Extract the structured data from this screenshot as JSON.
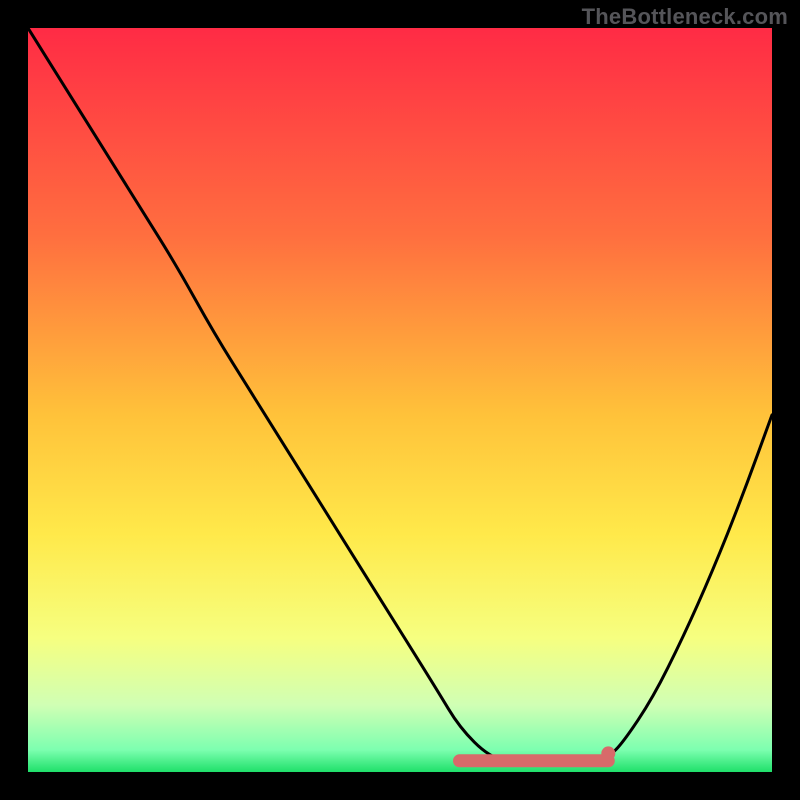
{
  "attribution": "TheBottleneck.com",
  "colors": {
    "gradient_top": "#ff2b45",
    "gradient_mid_upper": "#ff7a3c",
    "gradient_mid": "#ffd23f",
    "gradient_mid_lower": "#f6ff66",
    "gradient_lower": "#d6ffb0",
    "gradient_bottom": "#22e26b",
    "curve": "#000000",
    "highlight": "#d86a6a",
    "frame": "#000000"
  },
  "chart_data": {
    "type": "line",
    "title": "",
    "xlabel": "",
    "ylabel": "",
    "xlim": [
      0,
      1
    ],
    "ylim": [
      0,
      1
    ],
    "series": [
      {
        "name": "curve",
        "x": [
          0.0,
          0.05,
          0.1,
          0.15,
          0.2,
          0.25,
          0.3,
          0.35,
          0.4,
          0.45,
          0.5,
          0.55,
          0.58,
          0.62,
          0.66,
          0.7,
          0.74,
          0.78,
          0.8,
          0.84,
          0.88,
          0.92,
          0.96,
          1.0
        ],
        "y": [
          1.0,
          0.92,
          0.84,
          0.76,
          0.68,
          0.59,
          0.51,
          0.43,
          0.35,
          0.27,
          0.19,
          0.11,
          0.06,
          0.02,
          0.01,
          0.01,
          0.01,
          0.02,
          0.04,
          0.1,
          0.18,
          0.27,
          0.37,
          0.48
        ]
      }
    ],
    "highlight_segment": {
      "x_range": [
        0.58,
        0.78
      ],
      "y": 0.015
    },
    "marker": {
      "x": 0.78,
      "y": 0.025
    }
  }
}
